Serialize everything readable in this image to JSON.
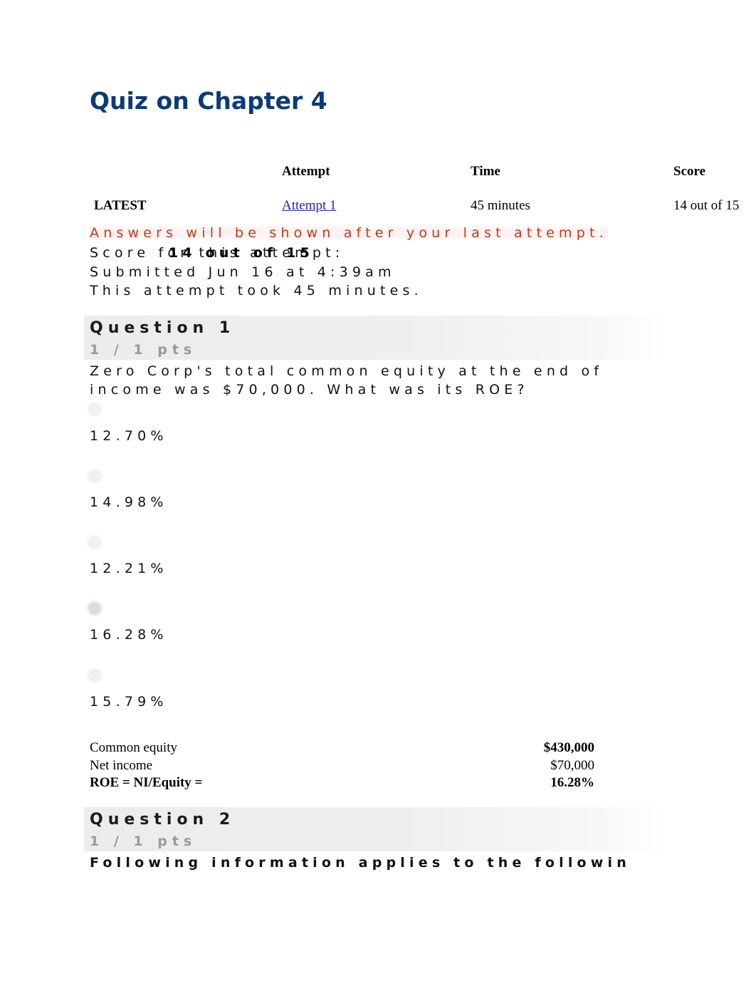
{
  "page": {
    "title": "Quiz on Chapter 4",
    "title_color": "#0d3b77"
  },
  "attempt_table": {
    "headers": {
      "flag": "",
      "attempt": "Attempt",
      "time": "Time",
      "score": "Score"
    },
    "rows": [
      {
        "flag": "LATEST",
        "attempt": "Attempt 1",
        "time": "45 minutes",
        "score": "14 out of 15"
      }
    ]
  },
  "meta": {
    "notice": "Answers will be shown after your last attempt.",
    "notice_color": "#c0391b",
    "score_for_attempt": "Score for this attempt:",
    "score_value": "14 out of 15",
    "submitted": "Submitted Jun 16 at 4:39am",
    "duration": "This attempt took 45 minutes."
  },
  "questions": [
    {
      "header": "Question 1",
      "points": "1 / 1 pts",
      "text_lines": [
        "Zero Corp's total common equity at the end of",
        "income was $70,000. What was its ROE?"
      ],
      "options": [
        {
          "label": "12.70%",
          "selected": false
        },
        {
          "label": "14.98%",
          "selected": false
        },
        {
          "label": "12.21%",
          "selected": false
        },
        {
          "label": "16.28%",
          "selected": true
        },
        {
          "label": "15.79%",
          "selected": false
        }
      ],
      "calc_rows": [
        {
          "label": "Common equity",
          "value": "$430,000",
          "label_bold": false,
          "value_bold": true
        },
        {
          "label": "Net income",
          "value": "$70,000",
          "label_bold": false,
          "value_bold": false
        },
        {
          "label": "ROE = NI/Equity =",
          "value": "16.28%",
          "label_bold": true,
          "value_bold": true
        }
      ]
    },
    {
      "header": "Question 2",
      "points": "1 / 1 pts",
      "text_lines": [
        "Following information applies to the followin"
      ],
      "options": [],
      "calc_rows": []
    }
  ]
}
